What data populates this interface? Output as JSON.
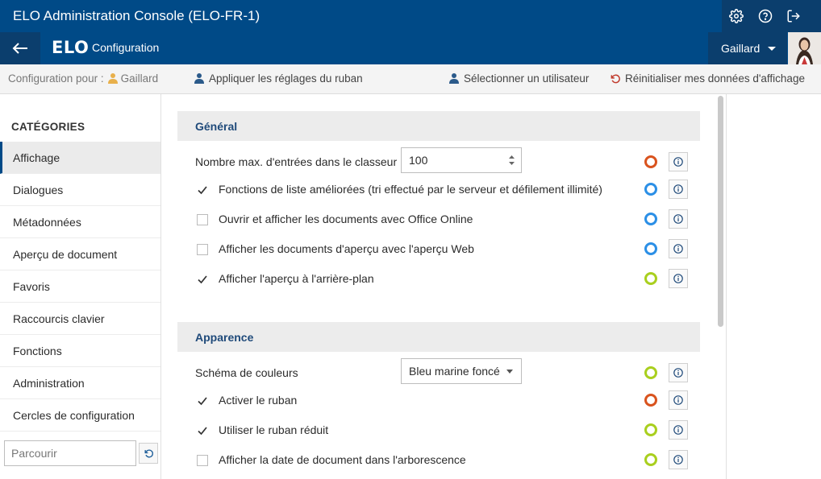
{
  "window": {
    "title": "ELO Administration Console (ELO-FR-1)"
  },
  "navbar": {
    "logo": "ELO",
    "section": "Configuration",
    "user": "Gaillard"
  },
  "toolbar": {
    "config_for_label": "Configuration pour :",
    "config_for_user": "Gaillard",
    "apply_ribbon": "Appliquer les réglages du ruban",
    "select_user": "Sélectionner un utilisateur",
    "reset_display": "Réinitialiser mes données d'affichage"
  },
  "sidebar": {
    "heading": "CATÉGORIES",
    "items": [
      {
        "label": "Affichage",
        "active": true
      },
      {
        "label": "Dialogues"
      },
      {
        "label": "Métadonnées"
      },
      {
        "label": "Aperçu de document"
      },
      {
        "label": "Favoris"
      },
      {
        "label": "Raccourcis clavier"
      },
      {
        "label": "Fonctions"
      },
      {
        "label": "Administration"
      },
      {
        "label": "Cercles de configuration"
      }
    ],
    "search_placeholder": "Parcourir"
  },
  "sections": {
    "general": {
      "title": "Général",
      "max_entries": {
        "label": "Nombre max. d'entrées dans le classeur",
        "value": "100",
        "state": "orange"
      },
      "rows": [
        {
          "label": "Fonctions de liste améliorées (tri effectué par le serveur et défilement illimité)",
          "checked": true,
          "state": "blue"
        },
        {
          "label": "Ouvrir et afficher les documents avec Office Online",
          "checked": false,
          "state": "blue"
        },
        {
          "label": "Afficher les documents d'aperçu avec l'aperçu Web",
          "checked": false,
          "state": "blue"
        },
        {
          "label": "Afficher l'aperçu à l'arrière-plan",
          "checked": true,
          "state": "green"
        }
      ]
    },
    "appearance": {
      "title": "Apparence",
      "color_scheme": {
        "label": "Schéma de couleurs",
        "value": "Bleu marine foncé",
        "state": "green"
      },
      "rows": [
        {
          "label": "Activer le ruban",
          "checked": true,
          "state": "orange"
        },
        {
          "label": "Utiliser le ruban réduit",
          "checked": true,
          "state": "green"
        },
        {
          "label": "Afficher la date de document dans l'arborescence",
          "checked": false,
          "state": "green"
        }
      ]
    }
  },
  "colors": {
    "brand": "#004a87",
    "brand_dark": "#0b3e6d",
    "state_blue": "#2b8fe6",
    "state_orange": "#d9531e",
    "state_green": "#a9cf1e"
  },
  "icons": {
    "settings": "gear-icon",
    "help": "help-icon",
    "logout": "logout-icon",
    "back": "back-arrow-icon",
    "user": "user-icon",
    "reset": "reset-icon",
    "info": "info-icon"
  }
}
